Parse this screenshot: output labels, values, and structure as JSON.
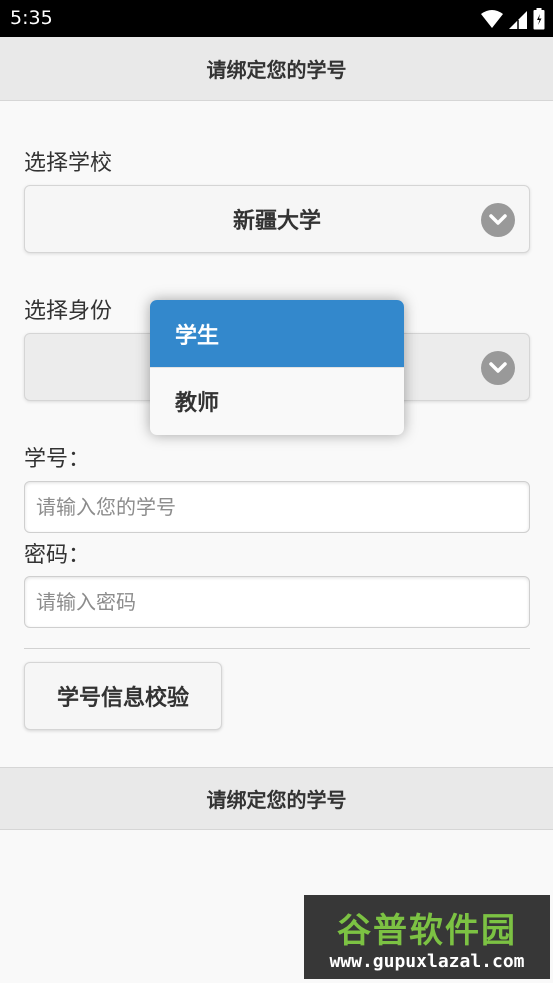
{
  "status_bar": {
    "time": "5:35"
  },
  "header": {
    "title": "请绑定您的学号"
  },
  "school": {
    "label": "选择学校",
    "value": "新疆大学"
  },
  "identity": {
    "label": "选择身份",
    "options": [
      "学生",
      "教师"
    ],
    "selected": "学生"
  },
  "student_id": {
    "label": "学号：",
    "placeholder": "请输入您的学号"
  },
  "password": {
    "label": "密码：",
    "placeholder": "请输入密码"
  },
  "verify_button": {
    "label": "学号信息校验"
  },
  "footer": {
    "title": "请绑定您的学号"
  },
  "watermark": {
    "brand": "谷普软件园",
    "url": "www.gupuxlazal.com"
  },
  "colors": {
    "accent": "#3388cc",
    "status_bar": "#000000",
    "header_bg": "#e9e9e9",
    "watermark_green": "#7cc243"
  }
}
